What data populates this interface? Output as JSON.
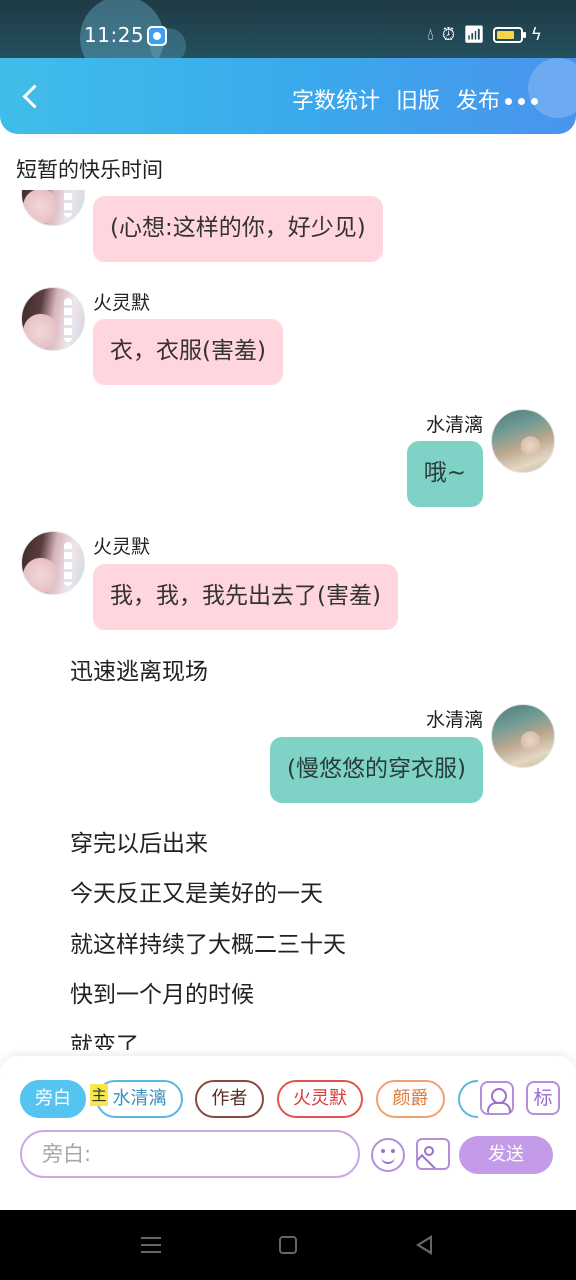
{
  "status_bar": {
    "time": "11:25",
    "icons": [
      "app-notification-icon",
      "water-drop-icon",
      "alarm-icon",
      "wifi-icon",
      "signal-icon",
      "battery-icon",
      "charging-icon"
    ]
  },
  "header": {
    "back_icon": "chevron-left-icon",
    "actions": [
      "字数统计",
      "旧版",
      "发布"
    ],
    "more_icon": "more-dots-icon"
  },
  "story_title": "短暂的快乐时间",
  "messages": [
    {
      "kind": "bubble",
      "side": "left",
      "character": "火灵默",
      "show_name": false,
      "text": "(心想:这样的你，好少见)"
    },
    {
      "kind": "bubble",
      "side": "left",
      "character": "火灵默",
      "show_name": true,
      "text": "衣，衣服(害羞)"
    },
    {
      "kind": "bubble",
      "side": "right",
      "character": "水清漓",
      "show_name": true,
      "text": "哦~"
    },
    {
      "kind": "bubble",
      "side": "left",
      "character": "火灵默",
      "show_name": true,
      "text": "我，我，我先出去了(害羞)"
    },
    {
      "kind": "narration",
      "text": "迅速逃离现场"
    },
    {
      "kind": "bubble",
      "side": "right",
      "character": "水清漓",
      "show_name": true,
      "text": "(慢悠悠的穿衣服)"
    },
    {
      "kind": "narration",
      "text": "穿完以后出来"
    },
    {
      "kind": "narration",
      "text": "今天反正又是美好的一天"
    },
    {
      "kind": "narration",
      "text": "就这样持续了大概二三十天"
    },
    {
      "kind": "narration",
      "text": "快到一个月的时候"
    },
    {
      "kind": "narration",
      "text": "就变了"
    }
  ],
  "role_chips": {
    "narration": "旁白",
    "main_tag": "主",
    "shui": "水清漓",
    "author": "作者",
    "huo": "火灵默",
    "yan": "颜爵",
    "mark": "标"
  },
  "input": {
    "placeholder": "旁白:",
    "value": ""
  },
  "send_label": "发送",
  "colors": {
    "header_start": "#40bde9",
    "header_end": "#4a94ee",
    "left_bubble": "#ffd6de",
    "right_bubble": "#7ed3c6",
    "send_button": "#c49be8"
  }
}
